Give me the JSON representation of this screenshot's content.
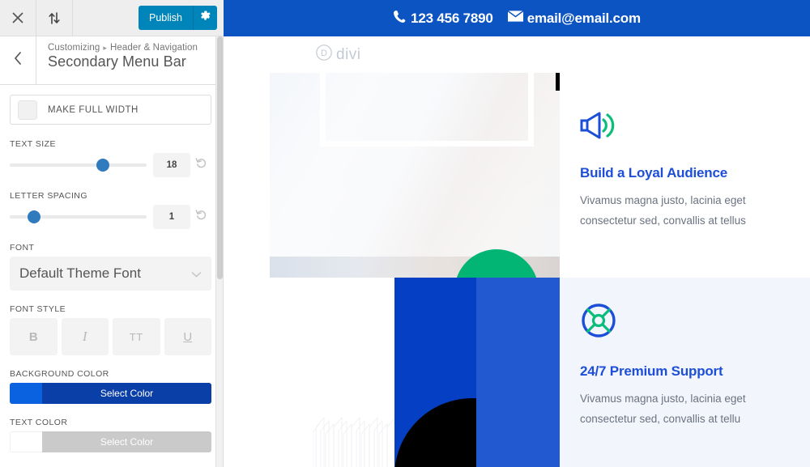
{
  "customizer": {
    "toolbar": {
      "close_icon": "close-icon",
      "collapse_icon": "sort-arrows-icon",
      "publish_label": "Publish",
      "gear_icon": "gear-icon"
    },
    "header": {
      "back_icon": "chevron-left-icon",
      "breadcrumb_root": "Customizing",
      "breadcrumb_sep": "▸",
      "breadcrumb_section": "Header & Navigation",
      "title": "Secondary Menu Bar"
    },
    "controls": {
      "make_full_width": {
        "label": "MAKE FULL WIDTH",
        "checked": false
      },
      "text_size": {
        "label": "TEXT SIZE",
        "value": "18",
        "percent": 68,
        "reset_icon": "reset-icon"
      },
      "letter_spacing": {
        "label": "LETTER SPACING",
        "value": "1",
        "percent": 18,
        "reset_icon": "reset-icon"
      },
      "font": {
        "label": "FONT",
        "value": "Default Theme Font",
        "caret_icon": "chevron-down-icon"
      },
      "font_style": {
        "label": "FONT STYLE",
        "options": [
          {
            "name": "bold",
            "glyph": "B"
          },
          {
            "name": "italic",
            "glyph": "I"
          },
          {
            "name": "uppercase",
            "glyph": "TT"
          },
          {
            "name": "underline",
            "glyph": "U"
          }
        ]
      },
      "background_color": {
        "label": "BACKGROUND COLOR",
        "button_label": "Select Color",
        "swatch_hex": "#0b62e0",
        "button_hex": "#0b3fa8"
      },
      "text_color": {
        "label": "TEXT COLOR",
        "button_label": "Select Color",
        "swatch_hex": "#ffffff",
        "button_hex": "#cacaca"
      }
    }
  },
  "preview": {
    "secondary_bar": {
      "background_hex": "#0c54c2",
      "phone_icon": "phone-icon",
      "phone": "123 456 7890",
      "email_icon": "envelope-icon",
      "email": "email@email.com"
    },
    "logo": {
      "mark": "D",
      "text": "divi"
    },
    "cards": [
      {
        "icon": "megaphone-icon",
        "title": "Build a Loyal Audience",
        "body": "Vivamus magna justo, lacinia eget consectetur sed, convallis at tellus"
      },
      {
        "icon": "lifebuoy-support-icon",
        "title": "24/7 Premium Support",
        "body": "Vivamus magna justo, lacinia eget consectetur sed, convallis at tellu"
      }
    ],
    "shapes": {
      "blue_dark_hex": "#0540c4",
      "blue_light_hex": "#2359d0",
      "green_hex": "#03b574",
      "black_hex": "#000000",
      "card2_bg_hex": "#f2f6fc"
    }
  }
}
